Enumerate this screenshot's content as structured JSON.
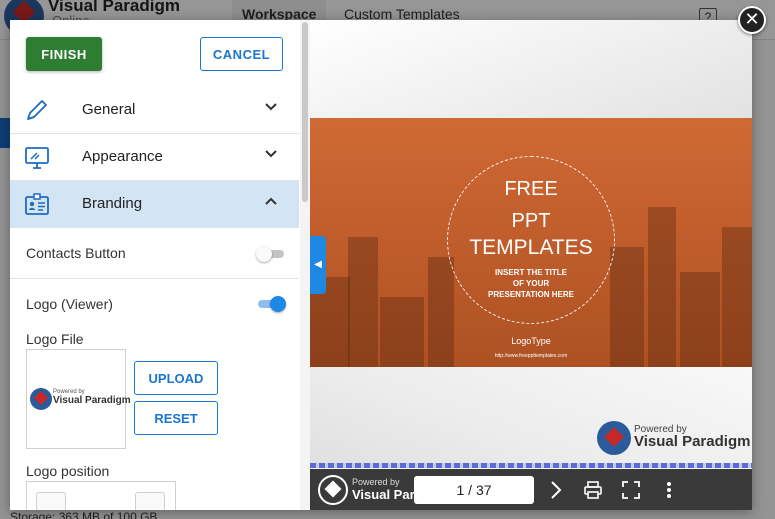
{
  "background": {
    "brand_name": "Visual Paradigm",
    "brand_sub": "Online",
    "tabs": [
      {
        "label": "Workspace"
      },
      {
        "label": "Custom Templates"
      }
    ],
    "help": "?",
    "storage_text": "Storage: 363 MB of 100 GB"
  },
  "panel": {
    "finish_label": "FINISH",
    "cancel_label": "CANCEL",
    "accordion": [
      {
        "label": "General",
        "icon": "pencil-icon",
        "state": "collapsed"
      },
      {
        "label": "Appearance",
        "icon": "monitor-icon",
        "state": "collapsed"
      },
      {
        "label": "Branding",
        "icon": "id-card-icon",
        "state": "expanded"
      }
    ],
    "branding": {
      "contacts_button_label": "Contacts Button",
      "contacts_button_on": false,
      "logo_viewer_label": "Logo (Viewer)",
      "logo_viewer_on": true,
      "logo_file_label": "Logo File",
      "logo_powered_by": "Powered by",
      "logo_brand": "Visual Paradigm",
      "upload_label": "UPLOAD",
      "reset_label": "RESET",
      "logo_position_label": "Logo position"
    }
  },
  "preview": {
    "slide": {
      "title_line1": "FREE",
      "title_line2": "PPT",
      "title_line3": "TEMPLATES",
      "subtitle_line1": "INSERT THE TITLE",
      "subtitle_line2": "OF YOUR",
      "subtitle_line3": "PRESENTATION HERE",
      "logotype": "LogoType",
      "url_text": "http://www.freeppttemplates.com",
      "powered_by": "Powered by",
      "brand": "Visual Paradigm"
    },
    "toolbar": {
      "powered_by": "Powered by",
      "brand": "Visual Paradigm",
      "page_indicator": "1 / 37",
      "current_page": 1,
      "total_pages": 37
    }
  },
  "colors": {
    "finish_green": "#2e7d32",
    "accent_blue": "#1976d2",
    "active_row": "#d3e4f5",
    "slide_orange": "#c35f2d"
  }
}
